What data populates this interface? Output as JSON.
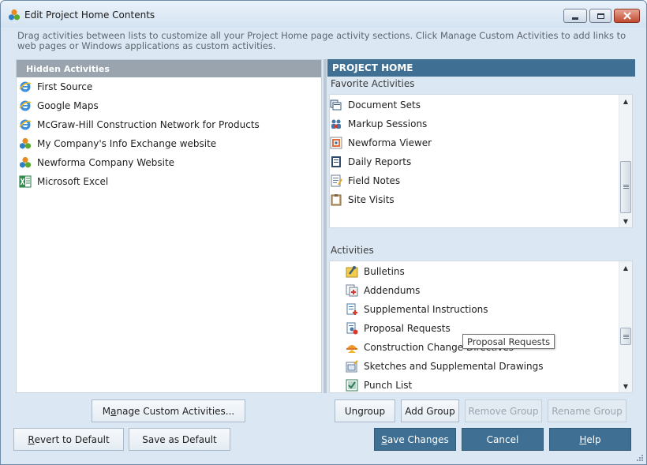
{
  "window": {
    "title": "Edit Project Home Contents",
    "instructions": "Drag activities between lists to customize all your Project Home page activity sections.  Click Manage Custom Activities to add links to web pages or Windows applications as custom activities."
  },
  "hidden_activities": {
    "header": "Hidden Activities",
    "items": [
      {
        "label": "First Source",
        "icon": "ie-icon"
      },
      {
        "label": "Google Maps",
        "icon": "ie-icon"
      },
      {
        "label": "McGraw-Hill Construction Network for Products",
        "icon": "ie-icon"
      },
      {
        "label": "My Company's Info Exchange website",
        "icon": "newforma-icon"
      },
      {
        "label": "Newforma Company Website",
        "icon": "newforma-icon"
      },
      {
        "label": "Microsoft Excel",
        "icon": "excel-icon"
      }
    ]
  },
  "project_home": {
    "header": "PROJECT HOME",
    "favorites_label": "Favorite Activities",
    "favorites": [
      {
        "label": "Document Sets",
        "icon": "document-sets-icon"
      },
      {
        "label": "Markup Sessions",
        "icon": "markup-sessions-icon"
      },
      {
        "label": "Newforma Viewer",
        "icon": "viewer-icon"
      },
      {
        "label": "Daily Reports",
        "icon": "daily-reports-icon"
      },
      {
        "label": "Field Notes",
        "icon": "field-notes-icon"
      },
      {
        "label": "Site Visits",
        "icon": "site-visits-icon"
      }
    ],
    "activities_label": "Activities",
    "activities": [
      {
        "label": "Bulletins",
        "icon": "bulletins-icon"
      },
      {
        "label": "Addendums",
        "icon": "addendums-icon"
      },
      {
        "label": "Supplemental Instructions",
        "icon": "supplemental-instructions-icon"
      },
      {
        "label": "Proposal Requests",
        "icon": "proposal-requests-icon"
      },
      {
        "label": "Construction Change Directives",
        "icon": "construction-change-icon"
      },
      {
        "label": "Sketches and Supplemental Drawings",
        "icon": "sketches-icon"
      },
      {
        "label": "Punch List",
        "icon": "punch-list-icon"
      }
    ]
  },
  "tooltip": "Proposal Requests",
  "buttons": {
    "manage_custom_pre": "M",
    "manage_custom_u": "a",
    "manage_custom_post": "nage Custom Activities...",
    "ungroup": "Ungroup",
    "add_group": "Add Group",
    "remove_group": "Remove Group",
    "rename_group": "Rename Group",
    "revert_u": "R",
    "revert_post": "evert to Default",
    "save_default": "Save as Default",
    "save_changes_u": "S",
    "save_changes_post": "ave Changes",
    "cancel": "Cancel",
    "help_u": "H",
    "help_post": "elp"
  },
  "colors": {
    "header_blue": "#3f6f92",
    "hidden_header_gray": "#9aa4ae",
    "window_bg": "#dbe8f3"
  }
}
